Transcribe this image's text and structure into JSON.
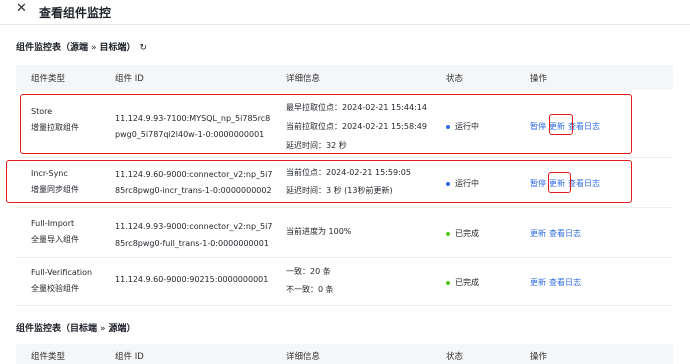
{
  "header": {
    "title": "查看组件监控"
  },
  "section1": {
    "title": "组件监控表（源端",
    "arrow": "»",
    "target": "目标端）",
    "refresh_glyph": "↻"
  },
  "section2": {
    "title": "组件监控表（目标端",
    "arrow": "»",
    "target": "源端）"
  },
  "columns": [
    "组件类型",
    "组件 ID",
    "详细信息",
    "状态",
    "操作"
  ],
  "rows": [
    {
      "type_en": "Store",
      "type_cn": "增量拉取组件",
      "id_line1": "11.124.9.93-7100:MYSQL_np_5i785rc8",
      "id_line2": "pwg0_5i787qi2l40w-1-0:0000000001",
      "details": [
        "最早拉取位点：2024-02-21 15:44:14",
        "当前拉取位点：2024-02-21 15:58:49",
        "延迟时间：32 秒"
      ],
      "status": "运行中",
      "status_color": "#2e6be6",
      "ops": [
        "暂停",
        "更新",
        "查看日志"
      ]
    },
    {
      "type_en": "Incr-Sync",
      "type_cn": "增量同步组件",
      "id_line1": "11.124.9.60-9000:connector_v2:np_5i7",
      "id_line2": "85rc8pwg0-incr_trans-1-0:0000000002",
      "details": [
        "当前位点：2024-02-21 15:59:05",
        "延迟时间：3 秒 (13秒前更新)"
      ],
      "status": "运行中",
      "status_color": "#2e6be6",
      "ops": [
        "暂停",
        "更新",
        "查看日志"
      ]
    },
    {
      "type_en": "Full-Import",
      "type_cn": "全量导入组件",
      "id_line1": "11.124.9.93-9000:connector_v2:np_5i7",
      "id_line2": "85rc8pwg0-full_trans-1-0:0000000001",
      "details": [
        "当前进度为 100%"
      ],
      "status": "已完成",
      "status_color": "#52c41a",
      "ops": [
        "更新",
        "查看日志"
      ]
    },
    {
      "type_en": "Full-Verification",
      "type_cn": "全量校验组件",
      "id_line1": "11.124.9.60-9000:90215:0000000001",
      "id_line2": "",
      "details": [
        "一致：20 条",
        "不一致：0 条"
      ],
      "status": "已完成",
      "status_color": "#52c41a",
      "ops": [
        "更新",
        "查看日志"
      ]
    }
  ],
  "colors": {
    "link": "#2e6be6",
    "highlight": "#e01b1b"
  }
}
